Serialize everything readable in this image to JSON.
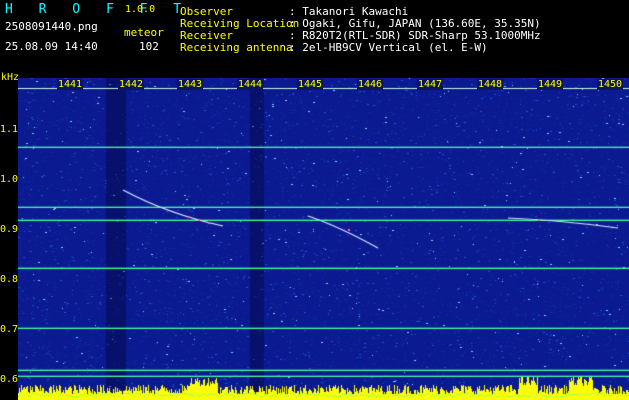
{
  "app": {
    "logo": "H R O F F T",
    "version": "1.0.0"
  },
  "file": {
    "name": "2508091440.png",
    "datetime": "25.08.09 14:40"
  },
  "meteor": {
    "label": "meteor",
    "count": "102"
  },
  "info": [
    {
      "key": "Observer",
      "value": ": Takanori Kawachi"
    },
    {
      "key": "Receiving Location",
      "value": ": Ogaki, Gifu, JAPAN (136.60E, 35.35N)"
    },
    {
      "key": "Receiver",
      "value": ": R820T2(RTL-SDR) SDR-Sharp 53.1000MHz"
    },
    {
      "key": "Receiving antenna",
      "value": ": 2el-HB9CV Vertical (el. E-W)"
    }
  ],
  "axis": {
    "unit": "kHz",
    "y_ticks": [
      "1.1",
      "1.0",
      "0.9",
      "0.8",
      "0.7",
      "0.6"
    ],
    "x_ticks": [
      "1441",
      "1442",
      "1443",
      "1444",
      "1445",
      "1446",
      "1447",
      "1448",
      "1449",
      "1450"
    ]
  },
  "colors": {
    "background": "#0a1a8c",
    "carrier": "#3cff9a",
    "meteor": "#ffffff",
    "bottom_band": "#ffff00"
  }
}
